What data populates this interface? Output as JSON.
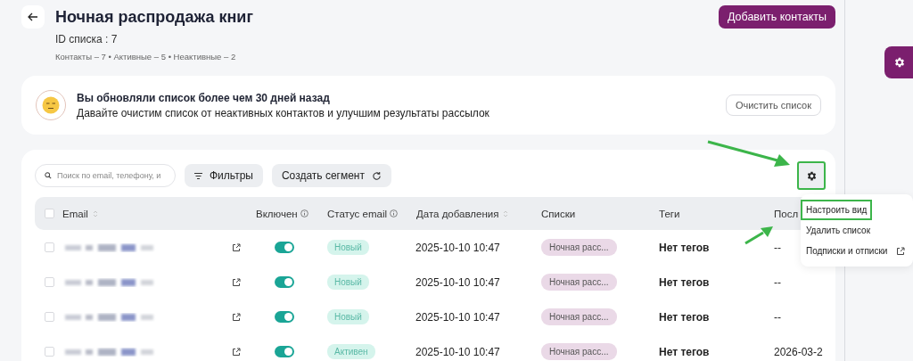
{
  "header": {
    "title": "Ночная распродажа книг",
    "list_id": "ID списка : 7",
    "stats": "Контакты – 7 • Активные – 5 • Неактивные – 2"
  },
  "add_button": "Добавить контакты",
  "notice": {
    "title": "Вы обновляли список более чем 30 дней назад",
    "text": "Давайте очистим список от неактивных контактов и улучшим результаты рассылок",
    "button": "Очистить список"
  },
  "toolbar": {
    "search_placeholder": "Поиск по email, телефону, и",
    "filters": "Фильтры",
    "segment": "Создать сегмент"
  },
  "settings_button": {
    "highlighted": true
  },
  "select_all": {
    "checked": false
  },
  "menu": [
    {
      "label": "Настроить вид",
      "highlighted": true,
      "external": false
    },
    {
      "label": "Удалить список",
      "highlighted": false,
      "external": false
    },
    {
      "label": "Подписки и отписки",
      "highlighted": false,
      "external": true
    }
  ],
  "columns": [
    {
      "label": "Email",
      "sortable": true,
      "info": false
    },
    {
      "label": "Включен",
      "sortable": false,
      "info": true
    },
    {
      "label": "Статус email",
      "sortable": false,
      "info": true
    },
    {
      "label": "Дата добавления",
      "sortable": true,
      "info": false
    },
    {
      "label": "Списки",
      "sortable": false,
      "info": false
    },
    {
      "label": "Теги",
      "sortable": false,
      "info": false
    },
    {
      "label": "Посл",
      "sortable": false,
      "info": false
    }
  ],
  "rows": [
    {
      "checked": false,
      "enabled": true,
      "status": "Новый",
      "date": "2025-10-10 10:47",
      "list": "Ночная расс...",
      "tags": "Нет тегов",
      "last": "--"
    },
    {
      "checked": false,
      "enabled": true,
      "status": "Новый",
      "date": "2025-10-10 10:47",
      "list": "Ночная расс...",
      "tags": "Нет тегов",
      "last": "--"
    },
    {
      "checked": false,
      "enabled": true,
      "status": "Новый",
      "date": "2025-10-10 10:47",
      "list": "Ночная расс...",
      "tags": "Нет тегов",
      "last": "--"
    },
    {
      "checked": false,
      "enabled": true,
      "status": "Активен",
      "date": "2025-10-10 10:47",
      "list": "Ночная расс...",
      "tags": "Нет тегов",
      "last": "2026-03-2"
    }
  ]
}
